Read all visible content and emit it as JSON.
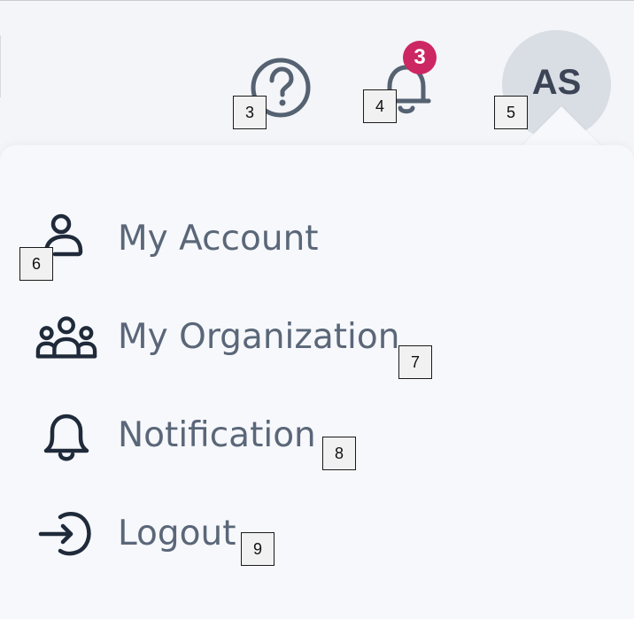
{
  "header": {
    "help_icon": "question-circle-icon",
    "notifications_icon": "bell-icon",
    "notification_count": "3",
    "avatar_initials": "AS"
  },
  "menu": {
    "items": [
      {
        "label": "My Account",
        "icon": "user-icon"
      },
      {
        "label": "My Organization",
        "icon": "users-group-icon"
      },
      {
        "label": "Notification",
        "icon": "bell-icon"
      },
      {
        "label": "Logout",
        "icon": "logout-icon"
      }
    ]
  },
  "markers": [
    "3",
    "4",
    "5",
    "6",
    "7",
    "8",
    "9"
  ],
  "colors": {
    "background": "#f4f5f8",
    "panel": "#f7f8fb",
    "text": "#5a6779",
    "icon_dark": "#1f2a3a",
    "header_icon": "#556272",
    "badge": "#cc2763",
    "avatar_bg": "#d9dde4"
  }
}
